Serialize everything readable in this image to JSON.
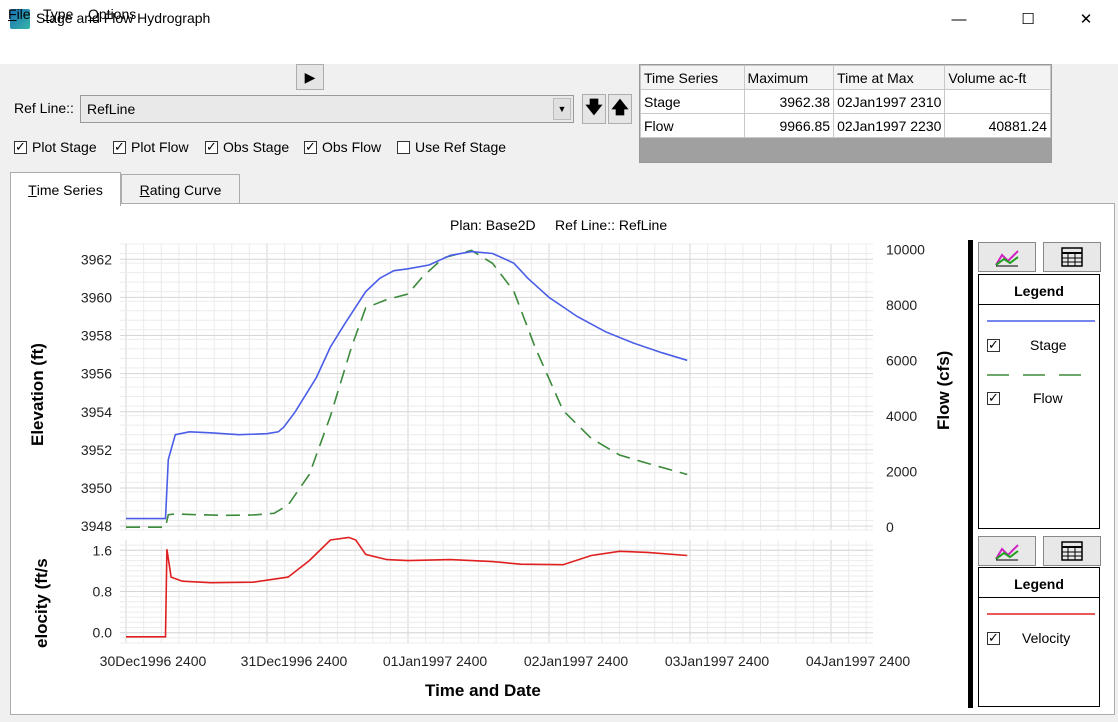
{
  "window": {
    "title": "Stage and Flow Hydrograph",
    "minimize": "—",
    "maximize": "☐",
    "close": "✕"
  },
  "menu": [
    {
      "first": "F",
      "rest": "ile"
    },
    {
      "first": "T",
      "rest": "ype"
    },
    {
      "first": "O",
      "rest": "ptions"
    }
  ],
  "controls": {
    "play_icon": "▶",
    "ref_label": "Ref Line::",
    "ref_value": "RefLine",
    "down_arrow": "🡇",
    "up_arrow": "🡅"
  },
  "checkboxes": [
    {
      "label": "Plot Stage",
      "checked": true
    },
    {
      "label": "Plot Flow",
      "checked": true
    },
    {
      "label": "Obs Stage",
      "checked": true
    },
    {
      "label": "Obs Flow",
      "checked": true
    },
    {
      "label": "Use Ref Stage",
      "checked": false
    }
  ],
  "summary": {
    "headers": [
      "Time Series",
      "Maximum",
      "Time at Max",
      "Volume ac-ft"
    ],
    "rows": [
      [
        "Stage",
        "3962.38",
        "02Jan1997 2310",
        ""
      ],
      [
        "Flow",
        "9966.85",
        "02Jan1997 2230",
        "40881.24"
      ]
    ]
  },
  "tabs": [
    {
      "first": "T",
      "rest": "ime Series"
    },
    {
      "first": "R",
      "rest": "ating Curve"
    }
  ],
  "chart_title": "Plan: Base2D     Ref Line:: RefLine",
  "legend": {
    "title": "Legend",
    "items_top": [
      {
        "label": "Stage",
        "color": "#4a5de8",
        "dash": "solid"
      },
      {
        "label": "Flow",
        "color": "#3c8a3c",
        "dash": "dashed"
      }
    ],
    "items_bottom": [
      {
        "label": "Velocity",
        "color": "#e02020",
        "dash": "solid"
      }
    ]
  },
  "chart_data": [
    {
      "type": "line",
      "title": "Plan: Base2D     Ref Line:: RefLine",
      "xlabel": "",
      "ylabel": "Elevation (ft)",
      "y2label": "Flow (cfs)",
      "ylim": [
        3947.8,
        3962.8
      ],
      "y2lim": [
        -100,
        10200
      ],
      "yticks": [
        3948,
        3950,
        3952,
        3954,
        3956,
        3958,
        3960,
        3962
      ],
      "y2ticks": [
        0,
        2000,
        4000,
        6000,
        8000,
        10000
      ],
      "series": [
        {
          "name": "Stage",
          "axis": "left",
          "color": "#4a5de8",
          "x": [
            0.0,
            0.28,
            0.3,
            0.35,
            0.45,
            0.6,
            0.8,
            1.0,
            1.08,
            1.12,
            1.2,
            1.35,
            1.45,
            1.55,
            1.7,
            1.8,
            1.9,
            2.0,
            2.15,
            2.3,
            2.45,
            2.6,
            2.75,
            2.85,
            3.0,
            3.2,
            3.4,
            3.6,
            3.8,
            3.98
          ],
          "y": [
            3948.4,
            3948.4,
            3951.5,
            3952.8,
            3952.95,
            3952.9,
            3952.8,
            3952.85,
            3952.95,
            3953.2,
            3954.0,
            3955.8,
            3957.4,
            3958.6,
            3960.3,
            3961.0,
            3961.4,
            3961.5,
            3961.7,
            3962.2,
            3962.4,
            3962.3,
            3961.8,
            3961.0,
            3960.0,
            3959.0,
            3958.2,
            3957.6,
            3957.1,
            3956.7
          ]
        },
        {
          "name": "Flow",
          "axis": "right",
          "color": "#3c8a3c",
          "x": [
            0.0,
            0.28,
            0.3,
            0.35,
            0.5,
            0.7,
            0.9,
            1.05,
            1.15,
            1.3,
            1.45,
            1.6,
            1.7,
            1.85,
            2.0,
            2.1,
            2.25,
            2.45,
            2.6,
            2.75,
            2.9,
            3.1,
            3.3,
            3.5,
            3.7,
            3.98
          ],
          "y": [
            0,
            0,
            450,
            480,
            450,
            430,
            440,
            500,
            800,
            1900,
            4000,
            6500,
            7900,
            8200,
            8400,
            9000,
            9700,
            9970,
            9500,
            8500,
            6500,
            4200,
            3200,
            2600,
            2300,
            1900
          ]
        }
      ]
    },
    {
      "type": "line",
      "xlabel": "Time and Date",
      "ylabel": "elocity (ft/s",
      "ylim": [
        -0.2,
        1.8
      ],
      "yticks": [
        "0.0",
        "0.8",
        "1.6"
      ],
      "xticks": [
        "30Dec1996 2400",
        "31Dec1996 2400",
        "01Jan1997 2400",
        "02Jan1997 2400",
        "03Jan1997 2400",
        "04Jan1997 2400"
      ],
      "series": [
        {
          "name": "Velocity",
          "color": "#e02020",
          "x": [
            0.0,
            0.28,
            0.29,
            0.32,
            0.4,
            0.6,
            0.9,
            1.15,
            1.3,
            1.45,
            1.58,
            1.63,
            1.7,
            1.85,
            2.0,
            2.3,
            2.6,
            2.8,
            3.1,
            3.3,
            3.5,
            3.7,
            3.98
          ],
          "y": [
            -0.08,
            -0.08,
            1.62,
            1.08,
            1.0,
            0.97,
            0.98,
            1.08,
            1.4,
            1.8,
            1.85,
            1.8,
            1.52,
            1.42,
            1.4,
            1.42,
            1.38,
            1.33,
            1.32,
            1.5,
            1.58,
            1.56,
            1.5
          ]
        }
      ]
    }
  ]
}
